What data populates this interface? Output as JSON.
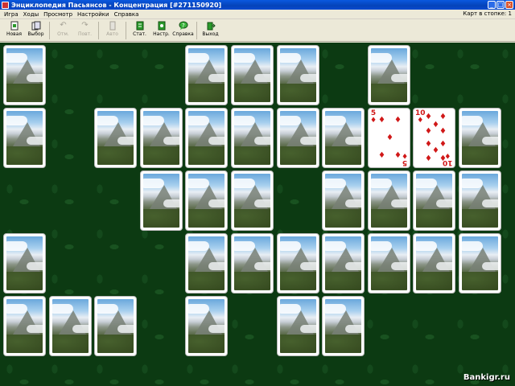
{
  "window": {
    "title": "Энциклопедия Пасьянсов - Концентрация [#271150920]"
  },
  "menu": {
    "items": [
      "Игра",
      "Ходы",
      "Просмотр",
      "Настройки",
      "Справка"
    ],
    "stock_label": "Карт в стопке:",
    "stock_count": "1"
  },
  "toolbar": {
    "new": "Новая",
    "choose": "Выбор",
    "undo": "Отм.",
    "redo": "Повт.",
    "auto": "Авто",
    "stats": "Стат.",
    "settings": "Настр.",
    "help": "Справка",
    "exit": "Выход"
  },
  "cards": {
    "five": {
      "rank": "5",
      "suit": "diamonds",
      "color": "#d01818"
    },
    "ten": {
      "rank": "10",
      "suit": "diamonds",
      "color": "#d01818"
    }
  },
  "watermark": "Bankigr.ru"
}
